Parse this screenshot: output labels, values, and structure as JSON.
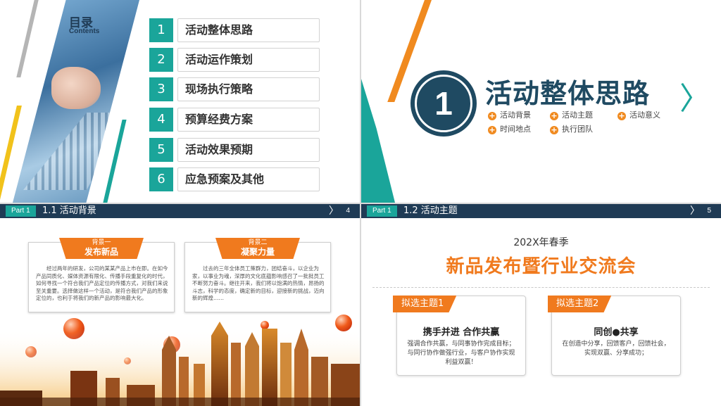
{
  "slide1": {
    "toc_title": "目录",
    "toc_subtitle": "Contents",
    "items": [
      {
        "num": "1",
        "label": "活动整体思路"
      },
      {
        "num": "2",
        "label": "活动运作策划"
      },
      {
        "num": "3",
        "label": "现场执行策略"
      },
      {
        "num": "4",
        "label": "预算经费方案"
      },
      {
        "num": "5",
        "label": "活动效果预期"
      },
      {
        "num": "6",
        "label": "应急预案及其他"
      }
    ]
  },
  "slide2": {
    "number": "1",
    "title": "活动整体思路",
    "chevron": "〉",
    "points": [
      "活动背景",
      "活动主题",
      "活动意义",
      "时间地点",
      "执行团队"
    ],
    "bullet_glyph": "+"
  },
  "slide3": {
    "part_tag": "Part 1",
    "part_title": "1.1 活动背景",
    "arrow": "〉",
    "page": "4",
    "cards": [
      {
        "tab_small": "背景一",
        "tab_big": "发布新品",
        "text": "经过两年的研发，公司的某某产品上市在即。在如今产品同质化、媒体资源有限化、传播手段重复化的时代，如何寻找一个符合我们产品定位的传播方式，对我们来说至关重要。选择做这样一个活动，是符合我们产品的形象定位的，也利于将我们的新产品的影响最大化。"
      },
      {
        "tab_small": "背景二",
        "tab_big": "凝聚力量",
        "text": "过去的三年全体员工策群力，团结奋斗，以企业为家，以事业为魂，深厚的文化底蕴影响感召了一批批员工不断努力奋斗。继往开来，我们将以饱满的热情，昂扬的斗志，科学的态度，确定新的目标，迎接新的挑战，迈向新的辉煌……"
      }
    ]
  },
  "slide4": {
    "part_tag": "Part 1",
    "part_title": "1.2 活动主题",
    "arrow": "〉",
    "page": "5",
    "year": "202X年春季",
    "title": "新品发布暨行业交流会",
    "cards": [
      {
        "tab": "拟选主题1",
        "heading": "携手并进  合作共赢",
        "desc": "强调合作共赢，与同事协作完成目标；与同行协作做强行业，与客户协作实现利益双赢！"
      },
      {
        "tab": "拟选主题2",
        "heading": "同创●共享",
        "desc": "在创造中分享，回馈客户，回馈社会，实现双赢、分享成功；"
      }
    ]
  },
  "colors": {
    "teal": "#1aa59a",
    "navy": "#1f3b55",
    "orange": "#f07a1e"
  }
}
